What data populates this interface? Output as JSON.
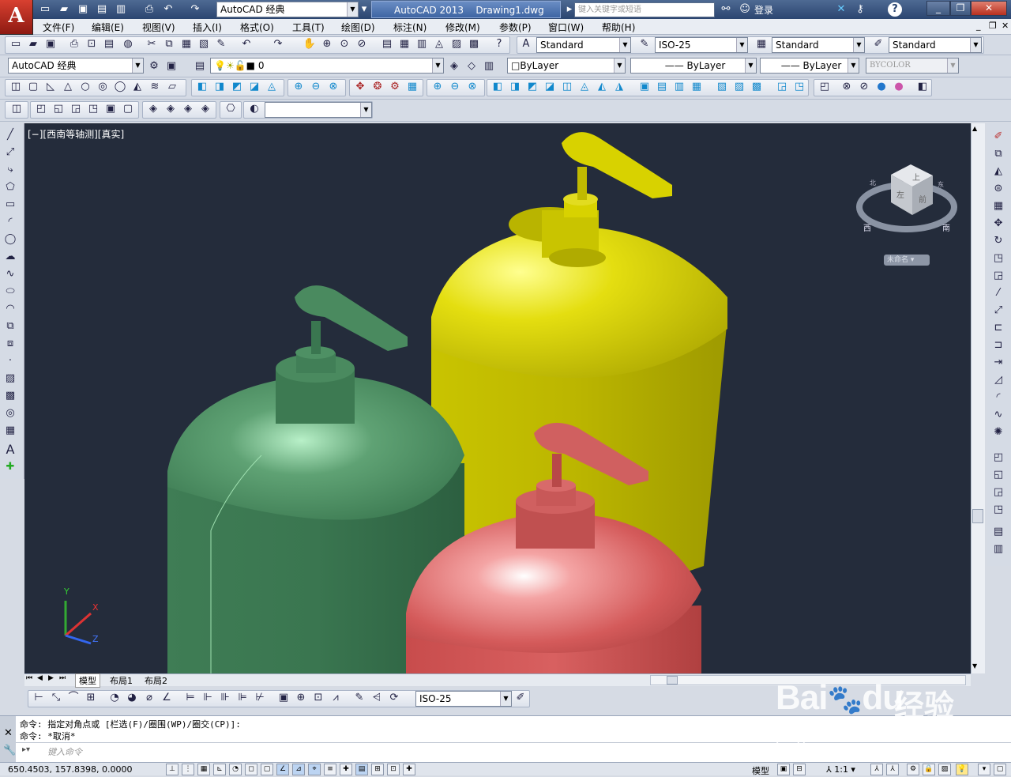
{
  "app": {
    "logo_letter": "A",
    "title": "AutoCAD 2013",
    "document": "Drawing1.dwg",
    "workspace": "AutoCAD 经典",
    "search_placeholder": "键入关键字或短语",
    "login_label": "登录",
    "help_label": "?"
  },
  "menu": [
    "文件(F)",
    "编辑(E)",
    "视图(V)",
    "插入(I)",
    "格式(O)",
    "工具(T)",
    "绘图(D)",
    "标注(N)",
    "修改(M)",
    "参数(P)",
    "窗口(W)",
    "帮助(H)"
  ],
  "styles": {
    "text_style": "Standard",
    "dim_style": "ISO-25",
    "table_style": "Standard",
    "mleader_style": "Standard"
  },
  "layers": {
    "workspace": "AutoCAD 经典",
    "current_layer": "0",
    "color": "ByLayer",
    "linetype": "ByLayer",
    "lineweight": "ByLayer",
    "plot_style": "BYCOLOR"
  },
  "viewport": {
    "label": "[−][西南等轴测][真实]",
    "background": "#242c3b",
    "viewcube": {
      "top": "上",
      "front": "前",
      "left": "左",
      "compass_w": "西",
      "compass_s": "南",
      "compass_n": "北",
      "compass_e": "东",
      "ucs_label": "未命名"
    },
    "ucs": {
      "x": "X",
      "y": "Y",
      "z": "Z"
    },
    "objects": [
      {
        "name": "green-bottle",
        "color": "#4a8a5a"
      },
      {
        "name": "yellow-bottle",
        "color": "#cfc60a"
      },
      {
        "name": "red-bottle",
        "color": "#d86060"
      }
    ]
  },
  "tabs": [
    "模型",
    "布局1",
    "布局2"
  ],
  "dim_toolbar": {
    "style": "ISO-25"
  },
  "command": {
    "line1": "命令: 指定对角点或 [栏选(F)/圈围(WP)/圈交(CP)]:",
    "line2": "命令: *取消*",
    "input_placeholder": "键入命令"
  },
  "status": {
    "coords": "650.4503, 157.8398, 0.0000",
    "model_label": "模型",
    "scale": "1:1"
  },
  "watermark": {
    "brand": "Bai",
    "brand2": "du",
    "text": "经验",
    "url": "jingyan.baidu.com"
  }
}
